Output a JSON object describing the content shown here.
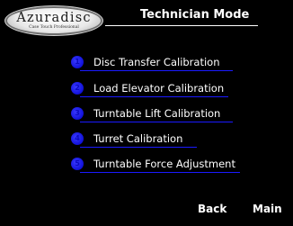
{
  "logo": {
    "name": "Azuradisc",
    "tagline": "Case Touch Professional"
  },
  "header": {
    "title": "Technician Mode"
  },
  "menu": {
    "accent_color": "#1a1aff",
    "items": [
      {
        "number": "1",
        "label": "Disc Transfer Calibration"
      },
      {
        "number": "2",
        "label": "Load Elevator Calibration"
      },
      {
        "number": "3",
        "label": "Turntable Lift Calibration"
      },
      {
        "number": "4",
        "label": "Turret Calibration"
      },
      {
        "number": "5",
        "label": "Turntable Force Adjustment"
      }
    ]
  },
  "footer": {
    "back_label": "Back",
    "main_label": "Main"
  }
}
